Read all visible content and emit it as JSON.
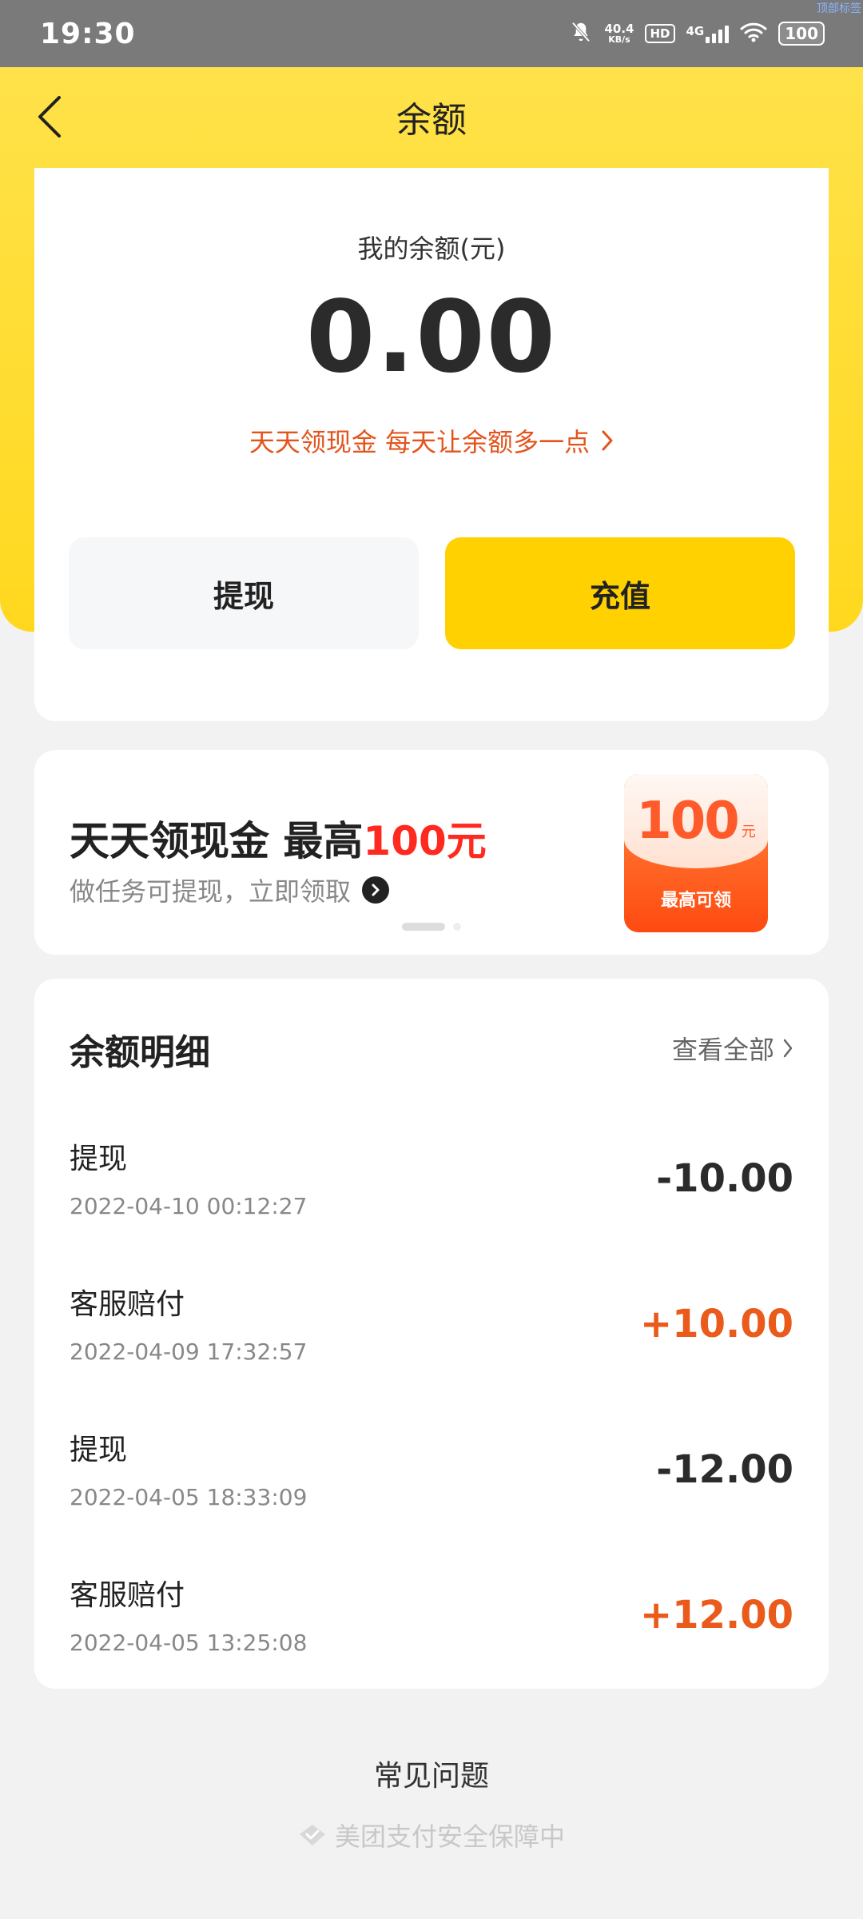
{
  "status_bar": {
    "time": "19:30",
    "net_speed_value": "40.4",
    "net_speed_unit": "KB/s",
    "hd_label": "HD",
    "network_type": "4G",
    "battery": "100",
    "corner_text": "顶部标签"
  },
  "header": {
    "title": "余额"
  },
  "balance": {
    "label": "我的余额(元)",
    "amount": "0.00",
    "promo_text": "天天领现金 每天让余额多一点",
    "withdraw_label": "提现",
    "recharge_label": "充值"
  },
  "promo_card": {
    "title_main": "天天领现金 最高",
    "title_highlight": "100元",
    "subtitle": "做任务可提现，立即领取",
    "packet_amount": "100",
    "packet_unit": "元",
    "packet_label": "最高可领",
    "accent_color": "#ff2a1f"
  },
  "details": {
    "title": "余额明细",
    "view_all": "查看全部",
    "rows": [
      {
        "title": "提现",
        "time": "2022-04-10 00:12:27",
        "amount": "-10.00",
        "type": "neg"
      },
      {
        "title": "客服赔付",
        "time": "2022-04-09 17:32:57",
        "amount": "+10.00",
        "type": "pos"
      },
      {
        "title": "提现",
        "time": "2022-04-05 18:33:09",
        "amount": "-12.00",
        "type": "neg"
      },
      {
        "title": "客服赔付",
        "time": "2022-04-05 13:25:08",
        "amount": "+12.00",
        "type": "pos"
      }
    ]
  },
  "footer": {
    "faq": "常见问题",
    "security": "美团支付安全保障中"
  },
  "colors": {
    "brand_yellow": "#ffd100",
    "positive": "#ea5a1a",
    "negative": "#2b2b2b"
  }
}
